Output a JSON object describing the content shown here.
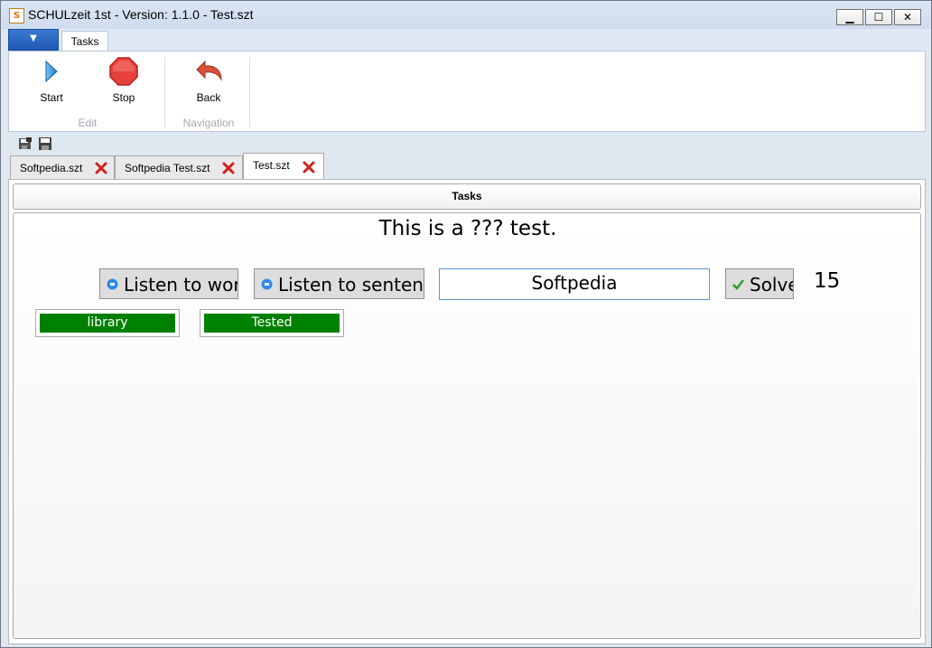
{
  "window": {
    "title": "SCHULzeit 1st - Version: 1.1.0 - Test.szt",
    "app_icon_text": "S",
    "controls": {
      "minimize": "▁",
      "maximize": "☐",
      "close": "✕"
    }
  },
  "ribbon": {
    "app_menu_glyph": "▼",
    "tab": "Tasks",
    "groups": [
      {
        "label": "Edit",
        "buttons": [
          {
            "label": "Start",
            "icon": "play-icon"
          },
          {
            "label": "Stop",
            "icon": "stop-icon"
          }
        ]
      },
      {
        "label": "Navigation",
        "buttons": [
          {
            "label": "Back",
            "icon": "back-arrow-icon"
          }
        ]
      }
    ]
  },
  "quick_access": [
    {
      "icon": "save-all-icon"
    },
    {
      "icon": "save-icon"
    }
  ],
  "document_tabs": [
    {
      "label": "Softpedia.szt",
      "active": false
    },
    {
      "label": "Softpedia Test.szt",
      "active": false
    },
    {
      "label": "Test.szt",
      "active": true
    }
  ],
  "content": {
    "header": "Tasks",
    "sentence": "This is a ??? test.",
    "buttons": {
      "listen_word": "Listen to word",
      "listen_sentence": "Listen to sentence",
      "solve": "Solve"
    },
    "answer_value": "Softpedia",
    "counter": "15",
    "tags": [
      {
        "label": "library"
      },
      {
        "label": "Tested"
      }
    ]
  },
  "colors": {
    "tag_fill": "#008000",
    "accent_blue": "#1f58b3",
    "close_red": "#d21f1f"
  }
}
